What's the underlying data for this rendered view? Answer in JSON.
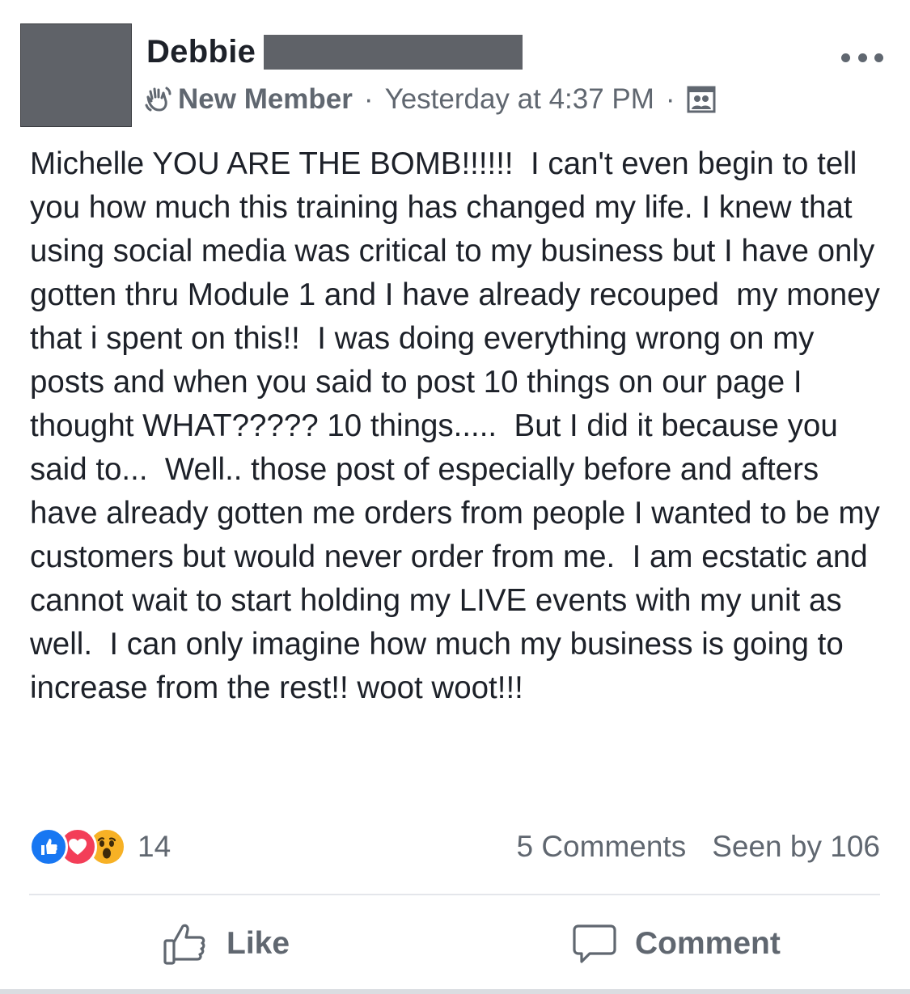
{
  "post": {
    "author_name": "Debbie",
    "badge": "New Member",
    "separator": "·",
    "timestamp": "Yesterday at 4:37 PM",
    "body": "Michelle YOU ARE THE BOMB!!!!!!  I can't even begin to tell you how much this training has changed my life. I knew that using social media was critical to my business but I have only gotten thru Module 1 and I have already recouped  my money that i spent on this!!  I was doing everything wrong on my posts and when you said to post 10 things on our page I thought WHAT????? 10 things.....  But I did it because you said to...  Well.. those post of especially before and afters have already gotten me orders from people I wanted to be my customers but would never order from me.  I am ecstatic and cannot wait to start holding my LIVE events with my unit as well.  I can only imagine how much my business is going to increase from the rest!! woot woot!!!"
  },
  "stats": {
    "reaction_count": "14",
    "comments": "5 Comments",
    "seen_by": "Seen by 106"
  },
  "actions": {
    "like_label": "Like",
    "comment_label": "Comment"
  },
  "colors": {
    "like_blue": "#1877f2",
    "love_red": "#f33e58",
    "wow_yellow": "#f7b125",
    "secondary_text": "#606770",
    "redaction": "#5f6268"
  },
  "icons": [
    "wave-icon",
    "group-icon",
    "more-icon",
    "like-reaction-icon",
    "love-reaction-icon",
    "wow-reaction-icon",
    "thumbs-up-icon",
    "comment-icon"
  ]
}
